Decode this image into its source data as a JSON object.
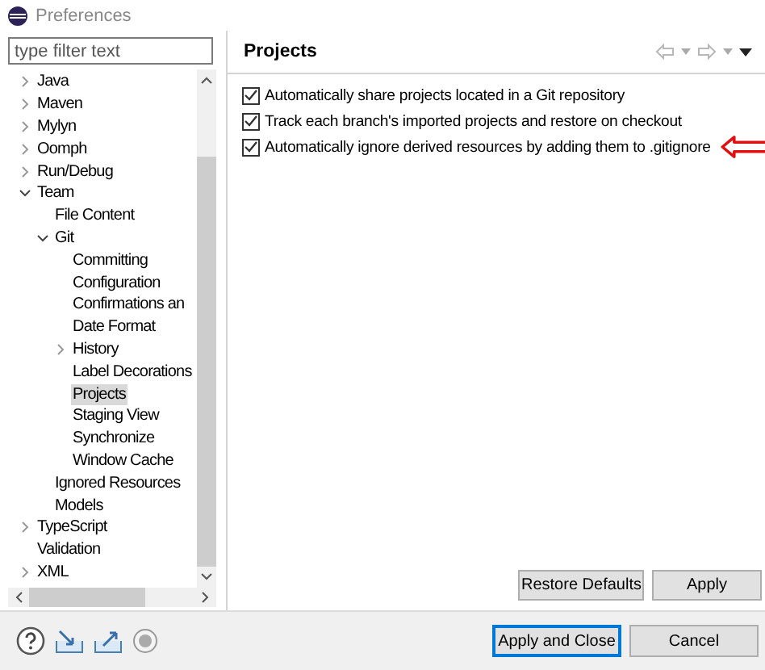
{
  "window": {
    "title": "Preferences"
  },
  "filter": {
    "placeholder": "type filter text"
  },
  "tree": [
    {
      "label": "Java",
      "kind": "folder",
      "expanded": false,
      "selected": false
    },
    {
      "label": "Maven",
      "kind": "folder",
      "expanded": false,
      "selected": false
    },
    {
      "label": "Mylyn",
      "kind": "folder",
      "expanded": false,
      "selected": false
    },
    {
      "label": "Oomph",
      "kind": "folder",
      "expanded": false,
      "selected": false
    },
    {
      "label": "Run/Debug",
      "kind": "folder",
      "expanded": false,
      "selected": false
    },
    {
      "label": "Team",
      "kind": "folder",
      "expanded": true,
      "selected": false,
      "children": [
        {
          "label": "File Content",
          "kind": "leaf",
          "selected": false
        },
        {
          "label": "Git",
          "kind": "folder",
          "expanded": true,
          "selected": false,
          "children": [
            {
              "label": "Committing",
              "kind": "leaf",
              "selected": false
            },
            {
              "label": "Configuration",
              "kind": "leaf",
              "selected": false
            },
            {
              "label": "Confirmations an",
              "kind": "leaf",
              "selected": false
            },
            {
              "label": "Date Format",
              "kind": "leaf",
              "selected": false
            },
            {
              "label": "History",
              "kind": "folder",
              "expanded": false,
              "selected": false
            },
            {
              "label": "Label Decorations",
              "kind": "leaf",
              "selected": false
            },
            {
              "label": "Projects",
              "kind": "leaf",
              "selected": true
            },
            {
              "label": "Staging View",
              "kind": "leaf",
              "selected": false
            },
            {
              "label": "Synchronize",
              "kind": "leaf",
              "selected": false
            },
            {
              "label": "Window Cache",
              "kind": "leaf",
              "selected": false
            }
          ]
        },
        {
          "label": "Ignored Resources",
          "kind": "leaf",
          "selected": false
        },
        {
          "label": "Models",
          "kind": "leaf",
          "selected": false
        }
      ]
    },
    {
      "label": "TypeScript",
      "kind": "folder",
      "expanded": false,
      "selected": false
    },
    {
      "label": "Validation",
      "kind": "leaf",
      "selected": false
    },
    {
      "label": "XML",
      "kind": "folder",
      "expanded": false,
      "selected": false
    }
  ],
  "page": {
    "title": "Projects",
    "options": [
      {
        "label": "Automatically share projects located in a Git repository",
        "checked": true
      },
      {
        "label": "Track each branch's imported projects and restore on checkout",
        "checked": true
      },
      {
        "label": "Automatically ignore derived resources by adding them to .gitignore",
        "checked": true,
        "annotated": true
      }
    ],
    "buttons": [
      "Restore Defaults",
      "Apply"
    ]
  },
  "footer": {
    "buttons": [
      {
        "label": "Apply and Close",
        "default": true
      },
      {
        "label": "Cancel",
        "default": false
      }
    ]
  }
}
